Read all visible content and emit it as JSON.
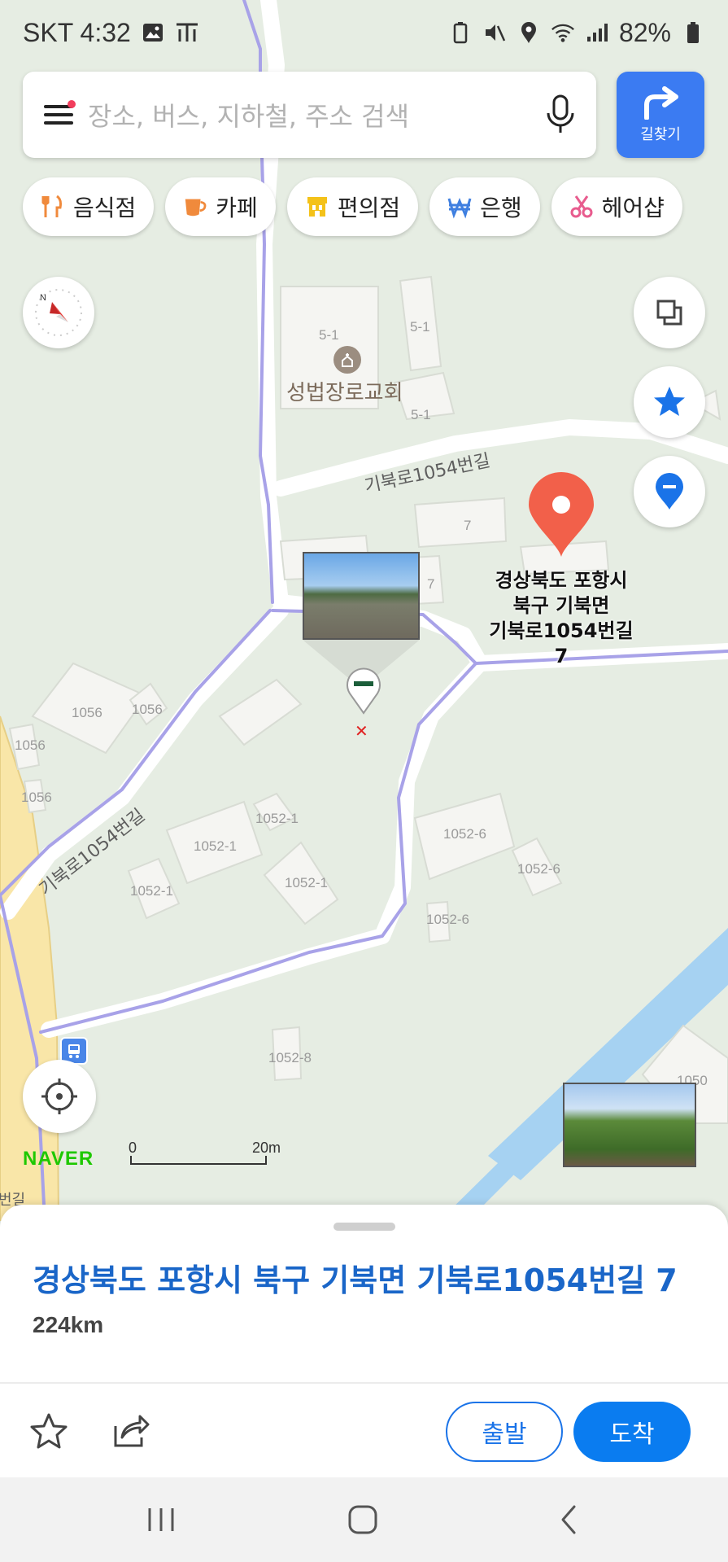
{
  "status_bar": {
    "carrier_time": "SKT 4:32",
    "battery": "82%",
    "icons": [
      "image-icon",
      "t-icon",
      "battery-saver-icon",
      "mute-icon",
      "location-icon",
      "wifi-icon",
      "signal-icon",
      "battery-icon"
    ]
  },
  "search": {
    "placeholder": "장소, 버스, 지하철, 주소 검색",
    "directions_label": "길찾기"
  },
  "categories": [
    {
      "label": "음식점",
      "icon": "fork-knife-icon",
      "color": "#f08a3c"
    },
    {
      "label": "카페",
      "icon": "coffee-cup-icon",
      "color": "#f08a3c"
    },
    {
      "label": "편의점",
      "icon": "store-icon",
      "color": "#f4c21a"
    },
    {
      "label": "은행",
      "icon": "won-icon",
      "color": "#3f7fe0"
    },
    {
      "label": "헤어샵",
      "icon": "scissors-icon",
      "color": "#e85c8e"
    }
  ],
  "map": {
    "church_name": "성법장로교회",
    "road_labels": [
      "기북로1054번길",
      "기북로1054번길",
      "번길"
    ],
    "lot_labels": [
      "5-1",
      "5-1",
      "5-1",
      "7",
      "7",
      "7",
      "1056",
      "1056",
      "1056",
      "1056",
      "1052-1",
      "1052-1",
      "1052-1",
      "1052-1",
      "1052-6",
      "1052-6",
      "1052-6",
      "1052-8",
      "1050"
    ],
    "pin_address_lines": [
      "경상북도 포항시",
      "북구 기북면",
      "기북로1054번길 7"
    ],
    "logo": "NAVER",
    "scale_start": "0",
    "scale_end": "20m"
  },
  "sheet": {
    "title": "경상북도 포항시 북구 기북면 기북로1054번길 7",
    "distance": "224km",
    "depart_label": "출발",
    "arrive_label": "도착"
  },
  "colors": {
    "accent": "#1a73e8",
    "road_purple": "#a8a2e8",
    "river": "#a6d2f2",
    "main_road": "#f9e6a8",
    "pin_red": "#f2604a"
  }
}
